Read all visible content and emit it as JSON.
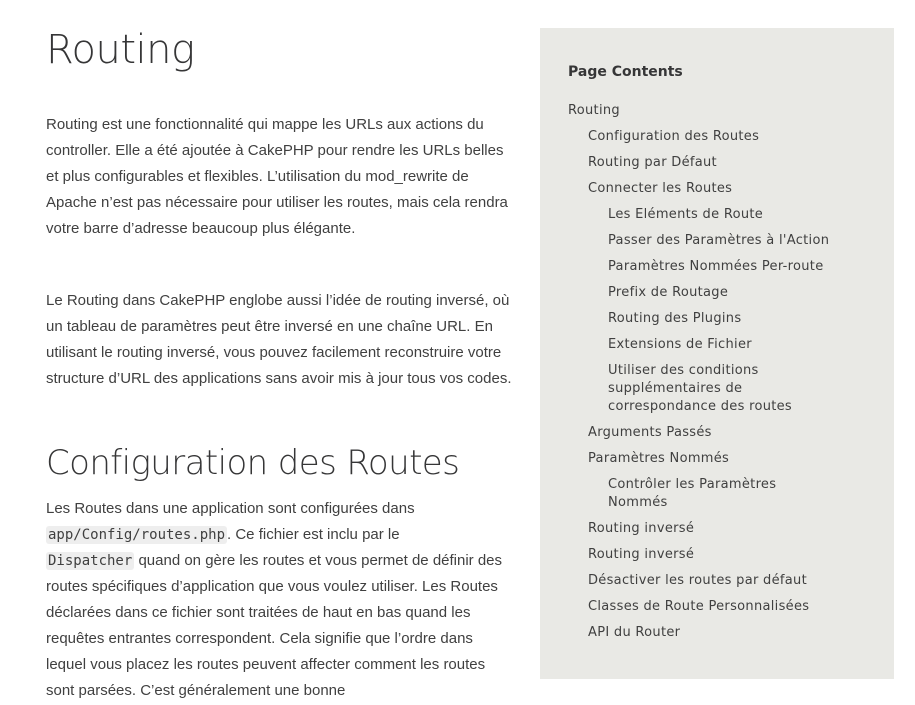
{
  "main": {
    "title": "Routing",
    "intro_paragraphs": [
      "Routing est une fonctionnalité qui mappe les URLs aux actions du controller. Elle a été ajoutée à CakePHP pour rendre les URLs belles et plus configurables et flexibles. L’utilisation du mod_rewrite de Apache n’est pas nécessaire pour utiliser les routes, mais cela rendra votre barre d’adresse beaucoup plus élégante.",
      "Le Routing dans CakePHP englobe aussi l’idée de routing inversé, où un tableau de paramètres peut être inversé en une chaîne URL. En utilisant le routing inversé, vous pouvez facilement reconstruire votre structure d’URL des applications sans avoir mis à jour tous vos codes."
    ],
    "section": {
      "title": "Configuration des Routes",
      "text_1": "Les Routes dans une application sont configurées dans",
      "code_1": "app/Config/routes.php",
      "text_2": ". Ce fichier est inclu par le",
      "code_2": "Dispatcher",
      "text_3": " quand on gère les routes et vous permet de définir des routes spécifiques d’application que vous voulez utiliser. Les Routes déclarées dans ce fichier sont traitées de haut en bas quand les requêtes entrantes correspondent. Cela signifie que l’ordre dans lequel vous placez les routes peuvent affecter comment les routes sont parsées. C’est généralement une bonne"
    }
  },
  "sidebar": {
    "title": "Page Contents",
    "items": [
      {
        "label": "Routing",
        "level": 0
      },
      {
        "label": "Configuration des Routes",
        "level": 1
      },
      {
        "label": "Routing par Défaut",
        "level": 1
      },
      {
        "label": "Connecter les Routes",
        "level": 1
      },
      {
        "label": "Les Eléments de Route",
        "level": 2
      },
      {
        "label": "Passer des Paramètres à l'Action",
        "level": 2
      },
      {
        "label": "Paramètres Nommées Per-route",
        "level": 2
      },
      {
        "label": "Prefix de Routage",
        "level": 2
      },
      {
        "label": "Routing des Plugins",
        "level": 2
      },
      {
        "label": "Extensions de Fichier",
        "level": 2
      },
      {
        "label": "Utiliser des conditions supplémentaires de correspondance des routes",
        "level": 2
      },
      {
        "label": "Arguments Passés",
        "level": 1
      },
      {
        "label": "Paramètres Nommés",
        "level": 1
      },
      {
        "label": "Contrôler les Paramètres Nommés",
        "level": 2
      },
      {
        "label": "Routing inversé",
        "level": 1
      },
      {
        "label": "Routing inversé",
        "level": 1
      },
      {
        "label": "Désactiver les routes par défaut",
        "level": 1
      },
      {
        "label": "Classes de Route Personnalisées",
        "level": 1
      },
      {
        "label": "API du Router",
        "level": 1
      }
    ]
  }
}
